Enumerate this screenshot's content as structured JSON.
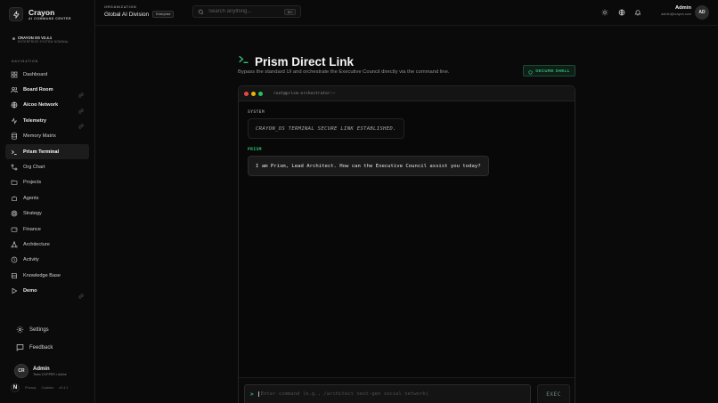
{
  "brand": {
    "title": "Crayon",
    "subtitle": "AI COMMAND CENTER"
  },
  "version": {
    "title": "CRAYON OS V2.4.1",
    "subtitle": "ENTERPRISE SYSTEM NOMINAL"
  },
  "sidebar": {
    "section_label": "NAVIGATION",
    "items": [
      {
        "label": "Dashboard"
      },
      {
        "label": "Board Room"
      },
      {
        "label": "Aicoo Network"
      },
      {
        "label": "Telemetry"
      },
      {
        "label": "Memory Matrix"
      },
      {
        "label": "Prism Terminal"
      },
      {
        "label": "Org Chart"
      },
      {
        "label": "Projects"
      },
      {
        "label": "Agents"
      },
      {
        "label": "Strategy"
      },
      {
        "label": "Finance"
      },
      {
        "label": "Architecture"
      },
      {
        "label": "Activity"
      },
      {
        "label": "Knowledge Base"
      },
      {
        "label": "Demo"
      }
    ],
    "settings_label": "Settings",
    "feedback_label": "Feedback",
    "user": {
      "initials": "CR",
      "name": "Admin",
      "meta": "Team COPPER • Active"
    },
    "footer": {
      "privacy": "Privacy",
      "cookies": "Cookies",
      "version": "v2.4.1"
    }
  },
  "topbar": {
    "org_label": "ORGANIZATION",
    "org_name": "Global AI Division",
    "org_badge": "Enterprise",
    "search_placeholder": "Search anything...",
    "search_kbd": "⌘K",
    "admin_name": "Admin",
    "admin_email": "admin@crayon.com",
    "admin_initials": "AD"
  },
  "main": {
    "title": "Prism Direct Link",
    "subtitle": "Bypass the standard UI and orchestrate the Executive Council directly via the command line.",
    "secure_badge": "SECURE SHELL",
    "terminal": {
      "path": "root@prism-orchestrator:~",
      "messages": [
        {
          "role": "SYSTEM",
          "text": "CRAYON_OS TERMINAL SECURE LINK ESTABLISHED."
        },
        {
          "role": "PRISM",
          "text": "I am Prism, Lead Architect. How can the Executive Council assist you today?"
        }
      ],
      "prompt": ">",
      "input_placeholder": "Enter command (e.g., /architect next-gen social network)",
      "exec_label": "EXEC"
    }
  },
  "colors": {
    "accent_green": "#34c27a",
    "dot_red": "#ef4444",
    "dot_yellow": "#eab308",
    "dot_green": "#22c55e"
  }
}
